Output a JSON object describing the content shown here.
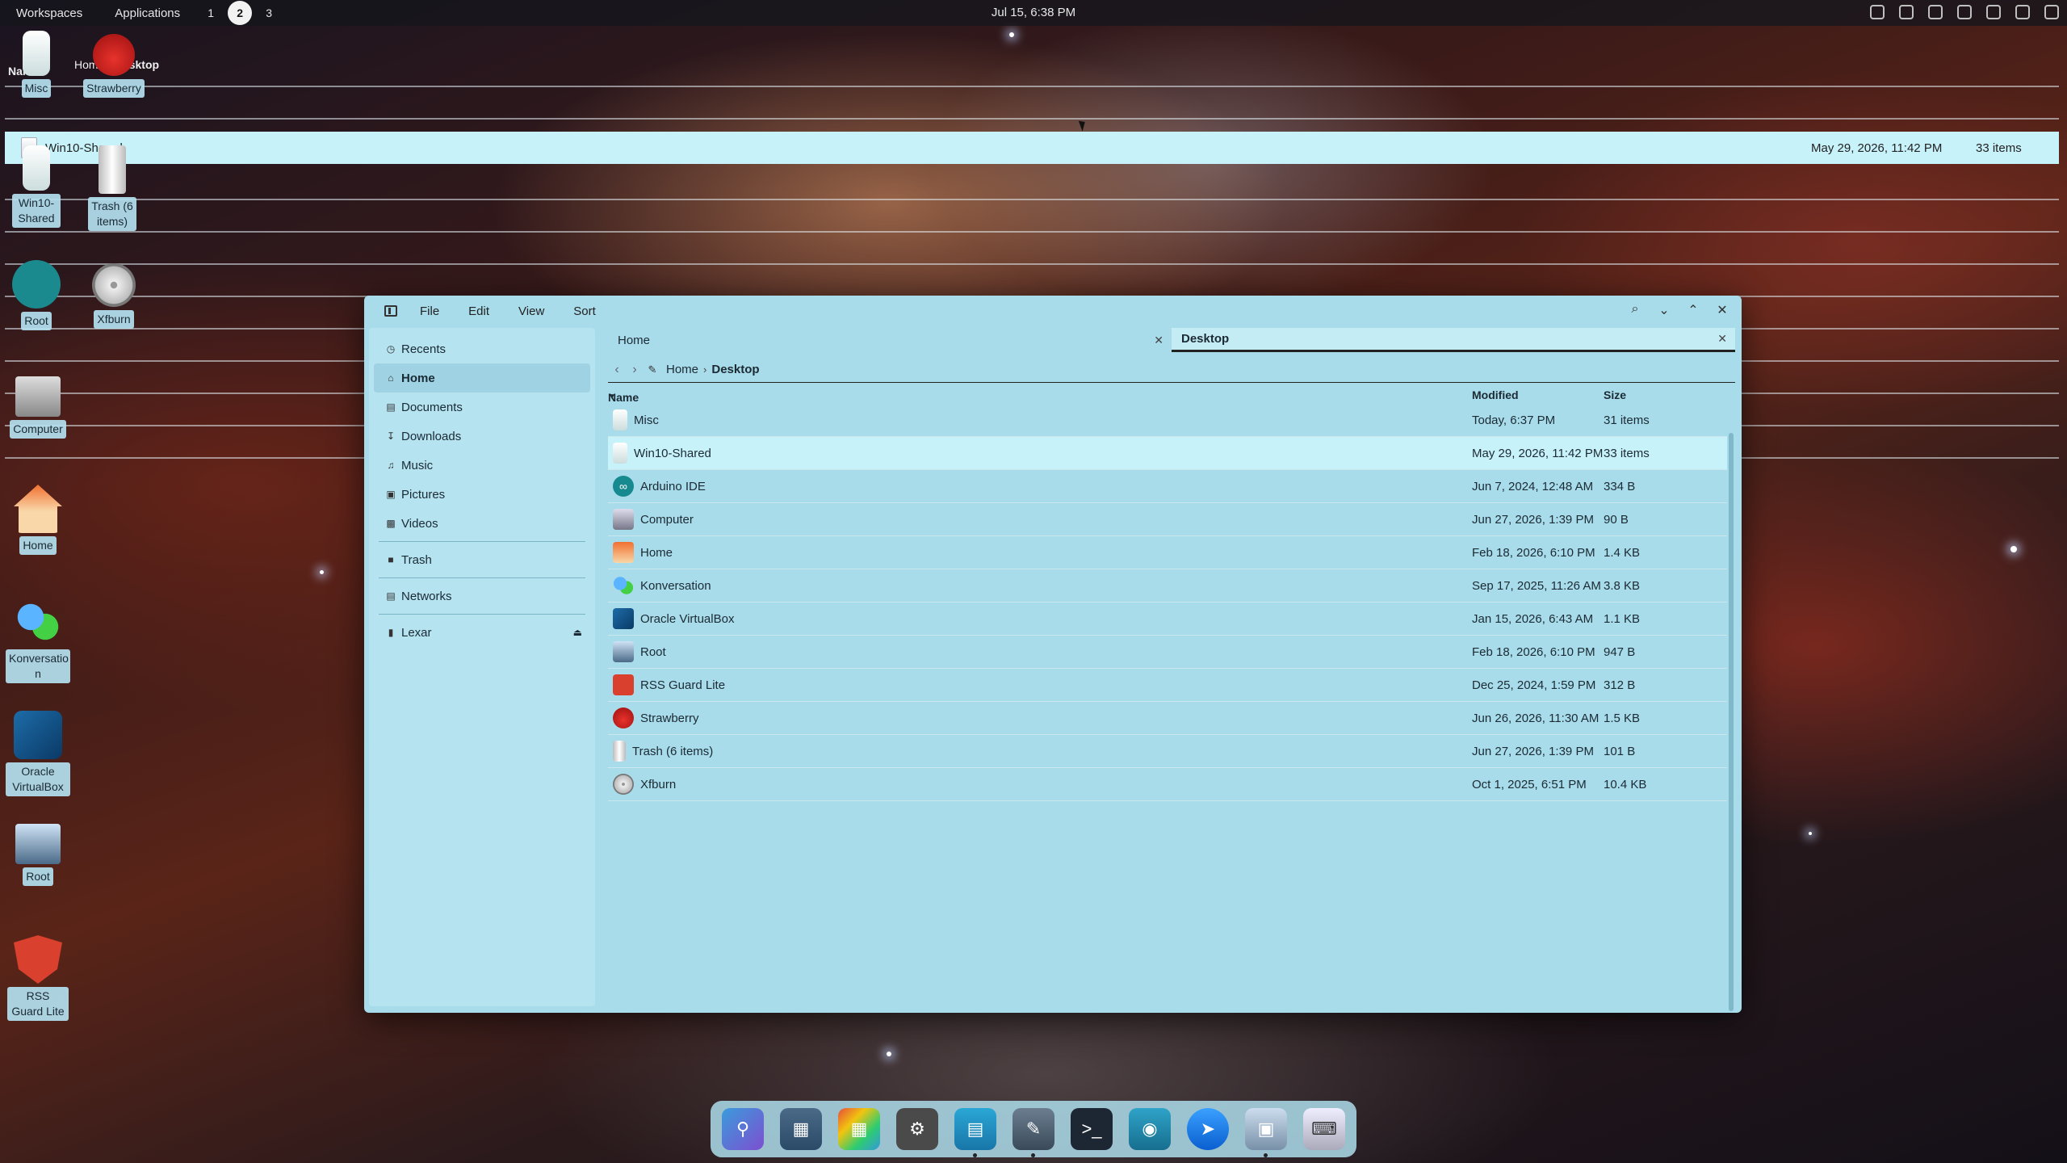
{
  "topbar": {
    "workspaces_label": "Workspaces",
    "applications_label": "Applications",
    "workspace_numbers": [
      "1",
      "2",
      "3"
    ],
    "active_workspace": "2",
    "clock": "Jul 15, 6:38 PM"
  },
  "ghost": {
    "crumb_home": "Home",
    "crumb_desktop": "Desktop",
    "name_header": "Name",
    "selected_name": "Win10-Shared",
    "selected_modified": "May 29, 2026, 11:42 PM",
    "selected_size": "33 items"
  },
  "desktop_icons": {
    "misc": "Misc",
    "strawberry": "Strawberry",
    "win10": "Win10-Shared",
    "trash": "Trash (6 items)",
    "rootide": "Root",
    "xfburn": "Xfburn",
    "computer": "Computer",
    "home": "Home",
    "konversation": "Konversatio n",
    "virtualbox": "Oracle VirtualBox",
    "root": "Root",
    "rssguard": "RSS Guard Lite"
  },
  "window": {
    "menu": [
      "File",
      "Edit",
      "View",
      "Sort"
    ],
    "sidebar": {
      "recents": "Recents",
      "home": "Home",
      "documents": "Documents",
      "downloads": "Downloads",
      "music": "Music",
      "pictures": "Pictures",
      "videos": "Videos",
      "trash": "Trash",
      "networks": "Networks",
      "lexar": "Lexar"
    },
    "tabs": [
      "Home",
      "Desktop"
    ],
    "path": [
      "Home",
      "Desktop"
    ],
    "columns": {
      "name": "Name",
      "modified": "Modified",
      "size": "Size"
    },
    "files": [
      {
        "name": "Misc",
        "modified": "Today, 6:37 PM",
        "size": "31 items"
      },
      {
        "name": "Win10-Shared",
        "modified": "May 29, 2026, 11:42 PM",
        "size": "33 items"
      },
      {
        "name": "Arduino IDE",
        "modified": "Jun 7, 2024, 12:48 AM",
        "size": "334 B"
      },
      {
        "name": "Computer",
        "modified": "Jun 27, 2026, 1:39 PM",
        "size": "90 B"
      },
      {
        "name": "Home",
        "modified": "Feb 18, 2026, 6:10 PM",
        "size": "1.4 KB"
      },
      {
        "name": "Konversation",
        "modified": "Sep 17, 2025, 11:26 AM",
        "size": "3.8 KB"
      },
      {
        "name": "Oracle VirtualBox",
        "modified": "Jan 15, 2026, 6:43 AM",
        "size": "1.1 KB"
      },
      {
        "name": "Root",
        "modified": "Feb 18, 2026, 6:10 PM",
        "size": "947 B"
      },
      {
        "name": "RSS Guard Lite",
        "modified": "Dec 25, 2024, 1:59 PM",
        "size": "312 B"
      },
      {
        "name": "Strawberry",
        "modified": "Jun 26, 2026, 11:30 AM",
        "size": "1.5 KB"
      },
      {
        "name": "Trash (6 items)",
        "modified": "Jun 27, 2026, 1:39 PM",
        "size": "101 B"
      },
      {
        "name": "Xfburn",
        "modified": "Oct 1, 2025, 6:51 PM",
        "size": "10.4 KB"
      }
    ],
    "selected_index": 1
  },
  "colors": {
    "window_bg": "#a8dceb",
    "selection": "#c8f2fa",
    "accent": "#1a2a35"
  }
}
